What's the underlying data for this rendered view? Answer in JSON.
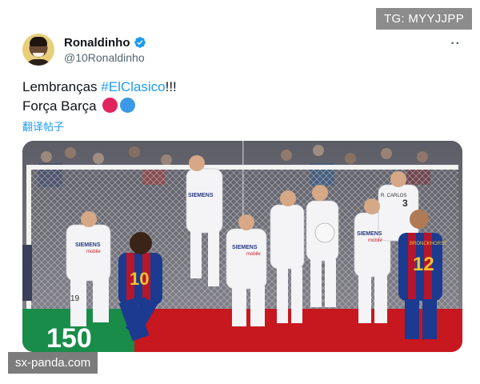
{
  "watermarks": {
    "top": "TG: MYYJJPP",
    "bottom": "sx-panda.com"
  },
  "author": {
    "display_name": "Ronaldinho",
    "handle": "@10Ronaldinho",
    "verified": true
  },
  "tweet": {
    "line1_prefix": "Lembranças ",
    "hashtag": "#ElClasico",
    "line1_suffix": "!!!",
    "line2": "Força Barça",
    "translate_label": "翻译帖子"
  },
  "icons": {
    "more": "more-options-icon",
    "verified": "verified-badge-icon"
  },
  "colors": {
    "accent": "#1d9bf0",
    "red_heart": "#e0245e",
    "blue_heart": "#3b9ae8"
  },
  "media": {
    "image_text": {
      "sponsor": "SIEMENS",
      "sponsor_sub": "mobile",
      "jersey_10": "10",
      "jersey_12": "12",
      "jersey_19": "19",
      "jersey_3": "3",
      "player_name": "R. CARLOS",
      "player_name_2": "BRONCKHORST",
      "board_text": "150"
    }
  }
}
